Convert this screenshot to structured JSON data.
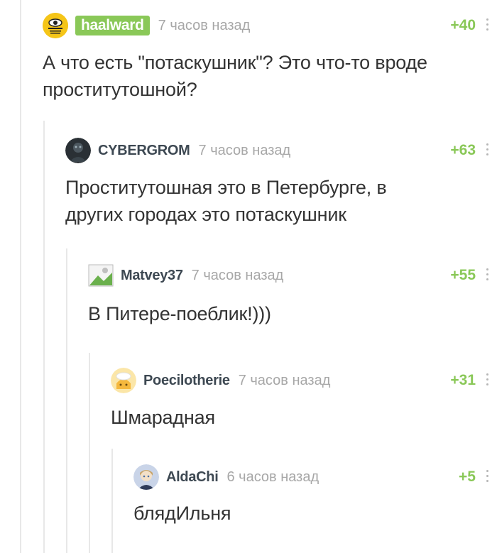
{
  "comments": [
    {
      "user": "haalward",
      "time": "7 часов назад",
      "rating": "+40",
      "text_lines": [
        "А что есть \"потаскушник\"? Это что-то вроде",
        "проститутошной?"
      ]
    },
    {
      "user": "CYBERGROM",
      "time": "7 часов назад",
      "rating": "+63",
      "text_lines": [
        "Проститутошная это в Петербурге, в",
        "других городах это потаскушник"
      ]
    },
    {
      "user": "Matvey37",
      "time": "7 часов назад",
      "rating": "+55",
      "text_lines": [
        "В Питере-поеблик!)))"
      ]
    },
    {
      "user": "Poecilotherie",
      "time": "7 часов назад",
      "rating": "+31",
      "text_lines": [
        "Шмарадная"
      ]
    },
    {
      "user": "AldaChi",
      "time": "6 часов назад",
      "rating": "+5",
      "text_lines": [
        "блядИльня"
      ]
    }
  ],
  "colors": {
    "accent": "#8ac858",
    "thread_line": "#e8e8e8",
    "muted": "#a7a7a7"
  },
  "icons": [
    "kebab-menu-icon",
    "avatar-image"
  ]
}
